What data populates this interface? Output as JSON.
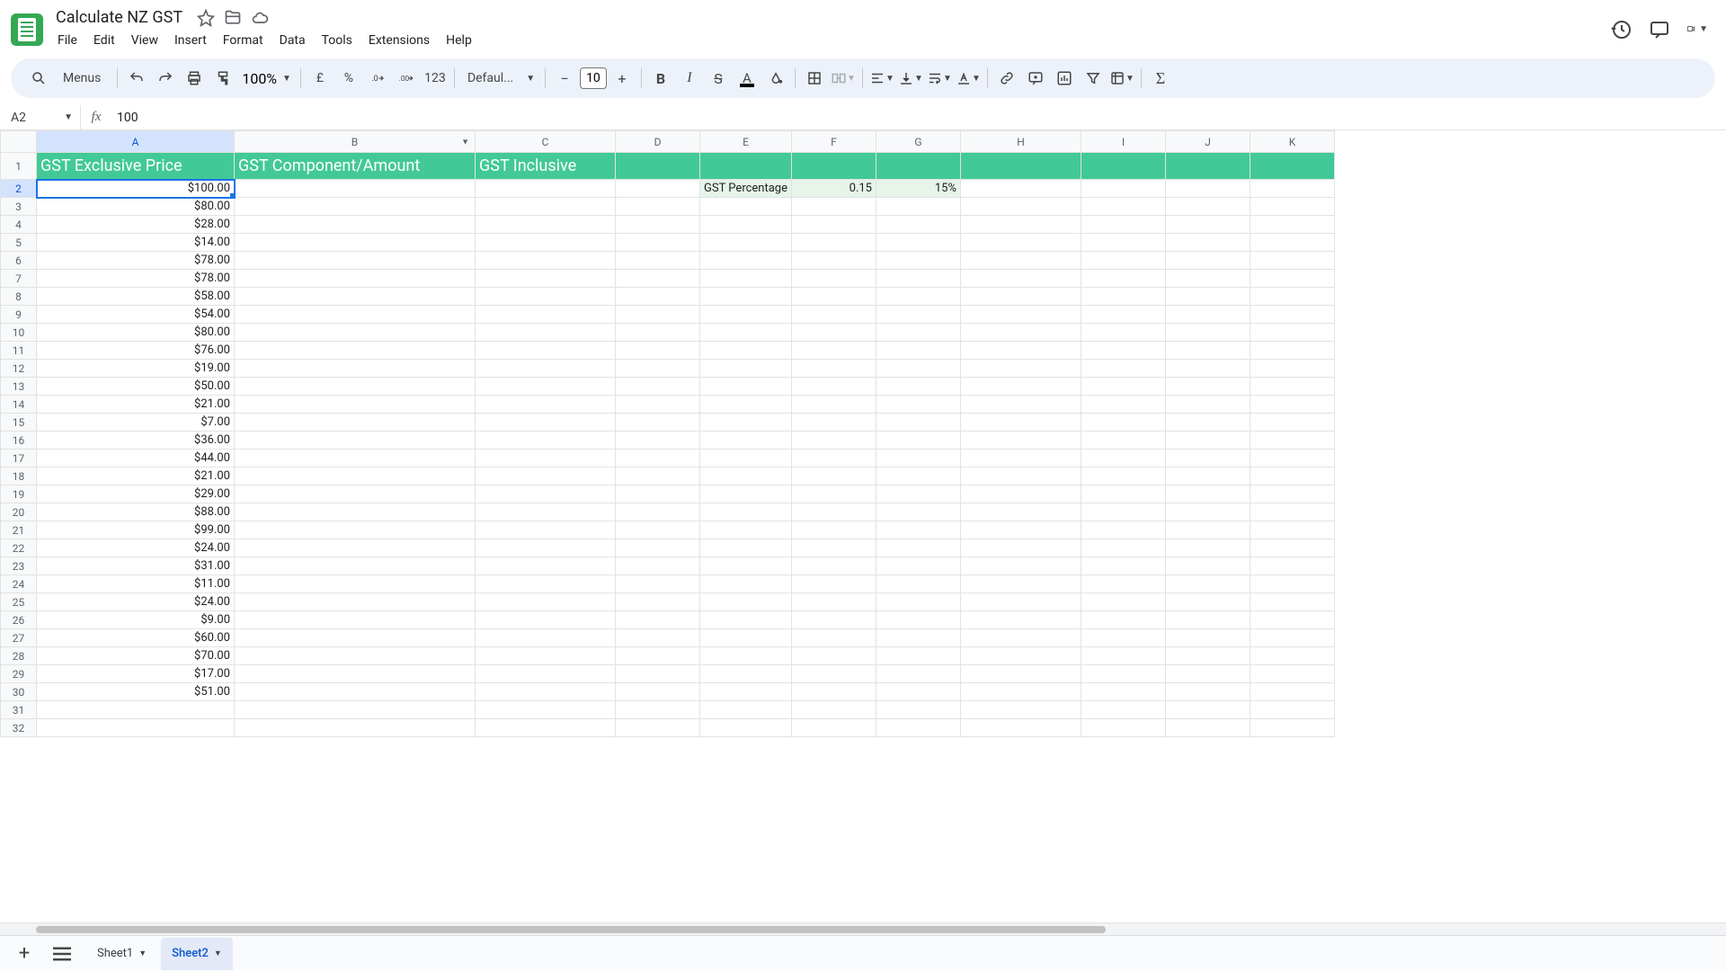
{
  "doc": {
    "title": "Calculate NZ GST"
  },
  "menus": [
    "File",
    "Edit",
    "View",
    "Insert",
    "Format",
    "Data",
    "Tools",
    "Extensions",
    "Help"
  ],
  "toolbar": {
    "search_placeholder": "Menus",
    "zoom": "100%",
    "currency": "£",
    "percent": "%",
    "num_fmt": "123",
    "font": "Defaul...",
    "font_size": "10"
  },
  "name_box": "A2",
  "formula": "100",
  "columns": [
    "A",
    "B",
    "C",
    "D",
    "E",
    "F",
    "G",
    "H",
    "I",
    "J",
    "K"
  ],
  "col_classes": [
    "cA",
    "cB",
    "cC",
    "cD",
    "cE",
    "cF",
    "cG",
    "cH",
    "cI",
    "cJ",
    "cK"
  ],
  "header_row": {
    "A": "GST Exclusive Price",
    "B": "GST Component/Amount",
    "C": "GST Inclusive"
  },
  "gst_label": "GST Percentage",
  "gst_decimal": "0.15",
  "gst_percent": "15%",
  "prices": [
    "$100.00",
    "$80.00",
    "$28.00",
    "$14.00",
    "$78.00",
    "$78.00",
    "$58.00",
    "$54.00",
    "$80.00",
    "$76.00",
    "$19.00",
    "$50.00",
    "$21.00",
    "$7.00",
    "$36.00",
    "$44.00",
    "$21.00",
    "$29.00",
    "$88.00",
    "$99.00",
    "$24.00",
    "$31.00",
    "$11.00",
    "$24.00",
    "$9.00",
    "$60.00",
    "$70.00",
    "$17.00",
    "$51.00"
  ],
  "total_rows": 32,
  "active_cell": {
    "row": 2,
    "col": "A"
  },
  "tabs": [
    {
      "name": "Sheet1",
      "active": false
    },
    {
      "name": "Sheet2",
      "active": true
    }
  ]
}
